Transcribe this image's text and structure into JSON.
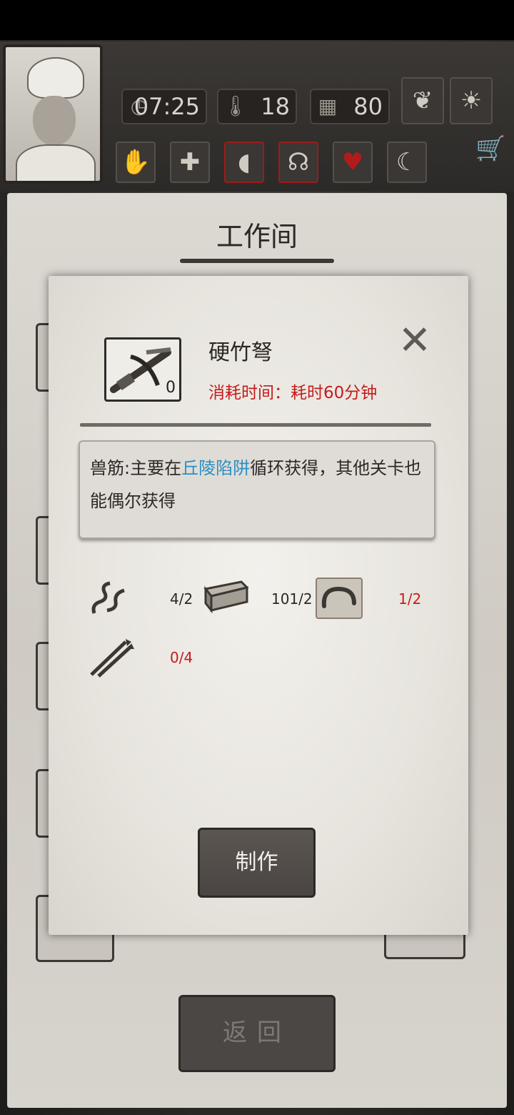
{
  "hud": {
    "time": "07:25",
    "temperature": "18",
    "calendar": "80",
    "icons": [
      "clock-icon",
      "thermometer-icon",
      "calendar-icon",
      "sprout-icon",
      "sun-icon"
    ]
  },
  "status_icons": [
    "hand-icon",
    "plus-icon",
    "stomach-icon",
    "brain-icon",
    "heart-icon",
    "moon-icon"
  ],
  "workshop": {
    "title": "工作间",
    "back_label": "返回"
  },
  "dialog": {
    "item_name": "硬竹弩",
    "item_count": "0",
    "time_label": "消耗时间：耗时60分钟",
    "description_prefix": "兽筋:主要在",
    "description_link": "丘陵陷阱",
    "description_suffix": "循环获得，其他关卡也能偶尔获得",
    "materials": [
      {
        "icon": "sinew-icon",
        "count": "4/2",
        "color": "#2b2825"
      },
      {
        "icon": "wood-plank-icon",
        "count": "101/2",
        "color": "#2b2825"
      },
      {
        "icon": "rope-icon",
        "count": "1/2",
        "color": "#c41c1c"
      },
      {
        "icon": "bamboo-arrows-icon",
        "count": "0/4",
        "color": "#c41c1c"
      }
    ],
    "make_label": "制作"
  }
}
